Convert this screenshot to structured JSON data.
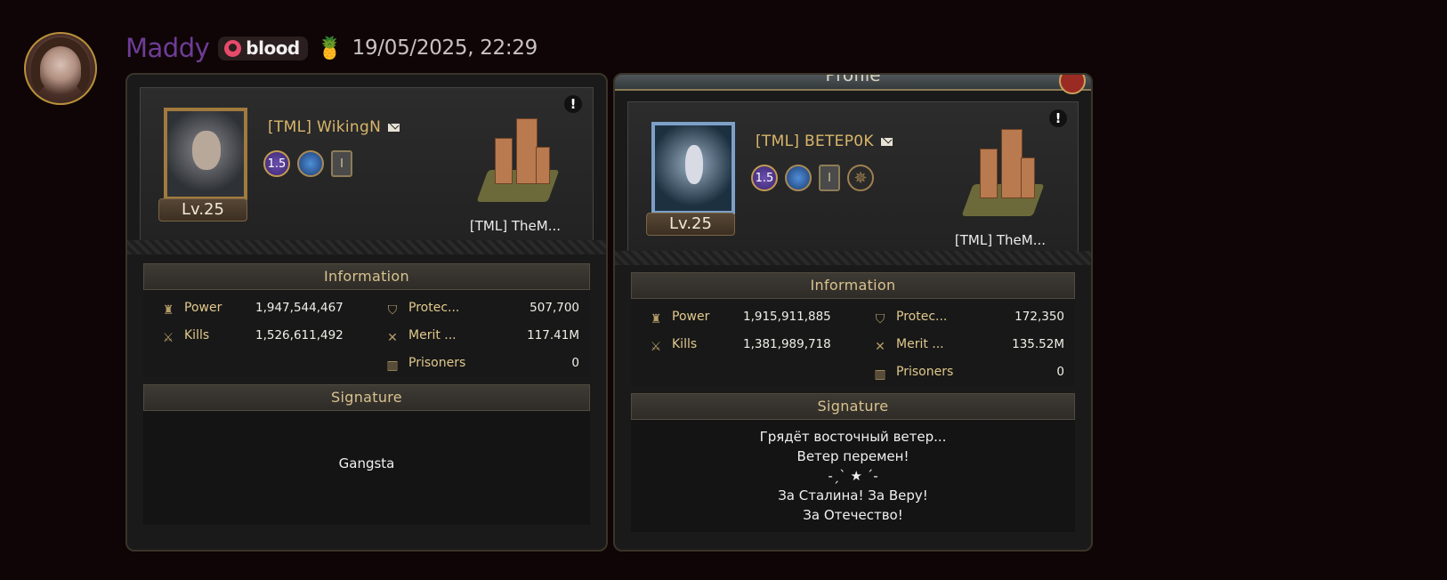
{
  "message": {
    "username": "Maddy",
    "tag": "blood",
    "timestamp": "19/05/2025, 22:29",
    "avatar_icon": "user-avatar",
    "emoji_icon": "pineapple-emoji",
    "username_color": "#6f3c97"
  },
  "cards": [
    {
      "player_name": "[TML] WikingN",
      "level": "Lv.25",
      "badge_level": "1.5",
      "badge_rank": "I",
      "castle_name": "[TML] TheM...",
      "info_header": "Information",
      "power_label": "Power",
      "power_value": "1,947,544,467",
      "kills_label": "Kills",
      "kills_value": "1,526,611,492",
      "protec_label": "Protec...",
      "protec_value": "507,700",
      "merit_label": "Merit ...",
      "merit_value": "117.41M",
      "prisoners_label": "Prisoners",
      "prisoners_value": "0",
      "signature_header": "Signature",
      "signature_lines": [
        "Gangsta"
      ]
    },
    {
      "title": "Profile",
      "player_name": "[TML] BETEP0K",
      "level": "Lv.25",
      "badge_level": "1.5",
      "badge_rank": "I",
      "castle_name": "[TML] TheM...",
      "info_header": "Information",
      "power_label": "Power",
      "power_value": "1,915,911,885",
      "kills_label": "Kills",
      "kills_value": "1,381,989,718",
      "protec_label": "Protec...",
      "protec_value": "172,350",
      "merit_label": "Merit ...",
      "merit_value": "135.52M",
      "prisoners_label": "Prisoners",
      "prisoners_value": "0",
      "signature_header": "Signature",
      "signature_lines": [
        "Грядёт восточный ветер...",
        "Ветер перемен!",
        "-ˏˋ ★ ˊ-",
        "За Сталина! За Веру!",
        "За Отечество!"
      ]
    }
  ]
}
